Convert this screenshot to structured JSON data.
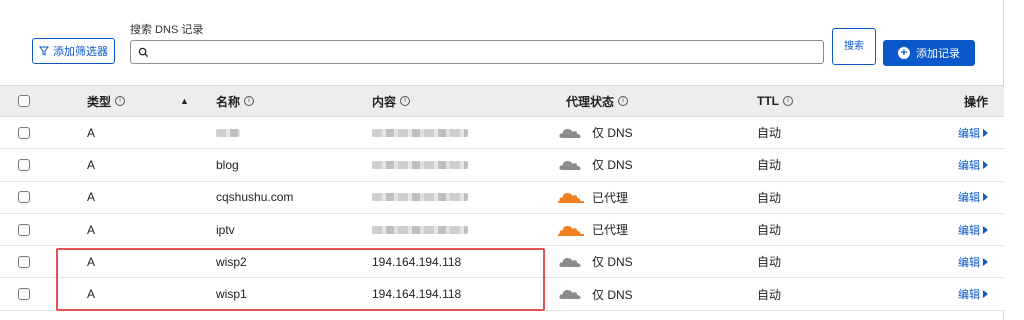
{
  "toolbar": {
    "filter_label": "添加筛选器",
    "search_label": "搜索 DNS 记录",
    "search_value": "",
    "search_button_label": "搜索",
    "add_record_label": "添加记录"
  },
  "table": {
    "headers": {
      "type": "类型",
      "name": "名称",
      "content": "内容",
      "proxy": "代理状态",
      "ttl": "TTL",
      "actions": "操作"
    },
    "rows": [
      {
        "type": "A",
        "name": "",
        "name_blurred": true,
        "content": "",
        "content_blurred": true,
        "proxy": "仅 DNS",
        "proxied": false,
        "ttl": "自动",
        "action": "编辑"
      },
      {
        "type": "A",
        "name": "blog",
        "name_blurred": false,
        "content": "",
        "content_blurred": true,
        "proxy": "仅 DNS",
        "proxied": false,
        "ttl": "自动",
        "action": "编辑"
      },
      {
        "type": "A",
        "name": "cqshushu.com",
        "name_blurred": false,
        "content": "",
        "content_blurred": true,
        "proxy": "已代理",
        "proxied": true,
        "ttl": "自动",
        "action": "编辑"
      },
      {
        "type": "A",
        "name": "iptv",
        "name_blurred": false,
        "content": "",
        "content_blurred": true,
        "proxy": "已代理",
        "proxied": true,
        "ttl": "自动",
        "action": "编辑"
      },
      {
        "type": "A",
        "name": "wisp2",
        "name_blurred": false,
        "content": "194.164.194.118",
        "content_blurred": false,
        "proxy": "仅 DNS",
        "proxied": false,
        "ttl": "自动",
        "action": "编辑"
      },
      {
        "type": "A",
        "name": "wisp1",
        "name_blurred": false,
        "content": "194.164.194.118",
        "content_blurred": false,
        "proxy": "仅 DNS",
        "proxied": false,
        "ttl": "自动",
        "action": "编辑"
      }
    ]
  },
  "colors": {
    "accent": "#0a58ca",
    "proxied_cloud": "#f38020",
    "dns_only_cloud": "#8c8c8c",
    "highlight": "#e05252"
  },
  "icons": {
    "filter": "filter-icon",
    "search": "search-icon",
    "add": "plus-circle-icon",
    "info": "info-icon",
    "sort": "sort-up-icon",
    "cloud": "cloud-icon",
    "edit": "caret-right-icon"
  }
}
